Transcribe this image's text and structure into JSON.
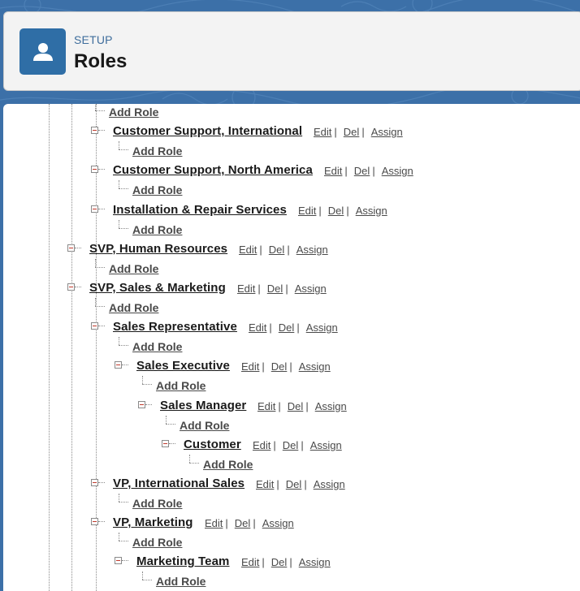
{
  "header": {
    "section": "SETUP",
    "title": "Roles"
  },
  "actions": {
    "edit": "Edit",
    "del": "Del",
    "assign": "Assign",
    "separator": "|"
  },
  "add_role_label": "Add Role",
  "tree": [
    {
      "type": "add",
      "level": 2
    },
    {
      "type": "role",
      "level": 2,
      "name": "Customer Support, International"
    },
    {
      "type": "add",
      "level": 3
    },
    {
      "type": "role",
      "level": 2,
      "name": "Customer Support, North America"
    },
    {
      "type": "add",
      "level": 3
    },
    {
      "type": "role",
      "level": 2,
      "name": "Installation & Repair Services"
    },
    {
      "type": "add",
      "level": 3
    },
    {
      "type": "role",
      "level": 1,
      "name": "SVP, Human Resources"
    },
    {
      "type": "add",
      "level": 2
    },
    {
      "type": "role",
      "level": 1,
      "name": "SVP, Sales & Marketing"
    },
    {
      "type": "add",
      "level": 2
    },
    {
      "type": "role",
      "level": 2,
      "name": "Sales Representative"
    },
    {
      "type": "add",
      "level": 3
    },
    {
      "type": "role",
      "level": 3,
      "name": "Sales Executive"
    },
    {
      "type": "add",
      "level": 4
    },
    {
      "type": "role",
      "level": 4,
      "name": "Sales Manager"
    },
    {
      "type": "add",
      "level": 5
    },
    {
      "type": "role",
      "level": 5,
      "name": "Customer"
    },
    {
      "type": "add",
      "level": 6
    },
    {
      "type": "role",
      "level": 2,
      "name": "VP, International Sales"
    },
    {
      "type": "add",
      "level": 3
    },
    {
      "type": "role",
      "level": 2,
      "name": "VP, Marketing"
    },
    {
      "type": "add",
      "level": 3
    },
    {
      "type": "role",
      "level": 3,
      "name": "Marketing Team"
    },
    {
      "type": "add",
      "level": 4
    }
  ]
}
